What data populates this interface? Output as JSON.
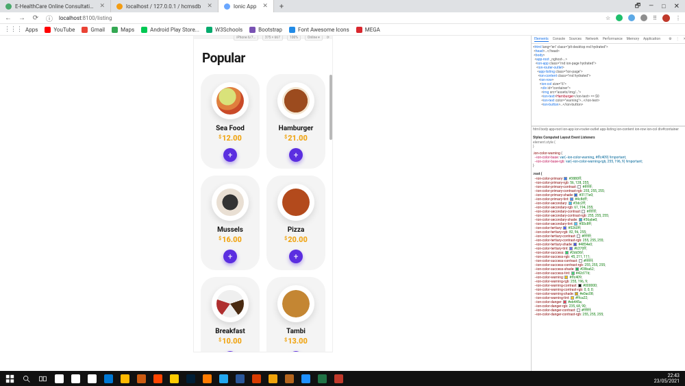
{
  "browser": {
    "tabs": [
      {
        "label": "E-HealthCare Online Consultati…",
        "favicon": "#4aa96c",
        "active": false
      },
      {
        "label": "localhost / 127.0.0.1 / hcmsdb",
        "favicon": "#f39c12",
        "active": false
      },
      {
        "label": "Ionic App",
        "favicon": "#6aa7ff",
        "active": true
      }
    ],
    "addr_host": "localhost",
    "addr_port_path": ":8100/listing",
    "bookmarks": [
      {
        "label": "Apps",
        "color": "#5f6368"
      },
      {
        "label": "YouTube",
        "color": "#ff0000"
      },
      {
        "label": "Gmail",
        "color": "#ea4335"
      },
      {
        "label": "Maps",
        "color": "#34a853"
      },
      {
        "label": "Android Play Store...",
        "color": "#00c853"
      },
      {
        "label": "W3Schools",
        "color": "#04aa6d"
      },
      {
        "label": "Bootstrap",
        "color": "#7952b3"
      },
      {
        "label": "Font Awesome Icons",
        "color": "#228be6"
      },
      {
        "label": "MEGA",
        "color": "#d9272e"
      }
    ]
  },
  "app": {
    "section_title": "Popular",
    "currency": "$",
    "items": [
      {
        "name": "Sea Food",
        "price": "12.00",
        "foodcls": "pf1"
      },
      {
        "name": "Hamburger",
        "price": "21.00",
        "foodcls": "pf2"
      },
      {
        "name": "Mussels",
        "price": "16.00",
        "foodcls": "pf3"
      },
      {
        "name": "Pizza",
        "price": "20.00",
        "foodcls": "pf4"
      },
      {
        "name": "Breakfast",
        "price": "10.00",
        "foodcls": "pf5"
      },
      {
        "name": "Tambi",
        "price": "13.00",
        "foodcls": "pf6"
      }
    ],
    "add_label": "+"
  },
  "devtools": {
    "tabs": [
      "Elements",
      "Console",
      "Sources",
      "Network",
      "Performance",
      "Memory",
      "Application"
    ],
    "active_tab": "Elements",
    "style_rule_selector": ".ion-color-warning",
    "style_rule_props": [
      "--ion-color-base: var(--ion-color-warning, #ffc409) !important;",
      "--ion-color-base-rgb: var(--ion-color-warning-rgb, 255, 196, 9) !important;"
    ],
    "color_vars": [
      {
        "name": "--ion-color-primary",
        "val": "#3880ff",
        "sw": "#3880ff"
      },
      {
        "name": "--ion-color-primary-rgb",
        "val": "56, 128, 255"
      },
      {
        "name": "--ion-color-primary-contrast",
        "val": "#ffffff",
        "sw": "#ffffff"
      },
      {
        "name": "--ion-color-primary-contrast-rgb",
        "val": "255, 255, 255"
      },
      {
        "name": "--ion-color-primary-shade",
        "val": "#3171e0",
        "sw": "#3171e0"
      },
      {
        "name": "--ion-color-primary-tint",
        "val": "#4c8dff",
        "sw": "#4c8dff"
      },
      {
        "name": "--ion-color-secondary",
        "val": "#3dc2ff",
        "sw": "#3dc2ff"
      },
      {
        "name": "--ion-color-secondary-rgb",
        "val": "61, 194, 255"
      },
      {
        "name": "--ion-color-secondary-contrast",
        "val": "#ffffff",
        "sw": "#ffffff"
      },
      {
        "name": "--ion-color-secondary-contrast-rgb",
        "val": "255, 255, 255"
      },
      {
        "name": "--ion-color-secondary-shade",
        "val": "#36abe0",
        "sw": "#36abe0"
      },
      {
        "name": "--ion-color-secondary-tint",
        "val": "#50c8ff",
        "sw": "#50c8ff"
      },
      {
        "name": "--ion-color-tertiary",
        "val": "#5260ff",
        "sw": "#5260ff"
      },
      {
        "name": "--ion-color-tertiary-rgb",
        "val": "82, 96, 255"
      },
      {
        "name": "--ion-color-tertiary-contrast",
        "val": "#ffffff",
        "sw": "#ffffff"
      },
      {
        "name": "--ion-color-tertiary-contrast-rgb",
        "val": "255, 255, 255"
      },
      {
        "name": "--ion-color-tertiary-shade",
        "val": "#4854e0",
        "sw": "#4854e0"
      },
      {
        "name": "--ion-color-tertiary-tint",
        "val": "#6370ff",
        "sw": "#6370ff"
      },
      {
        "name": "--ion-color-success",
        "val": "#2dd36f",
        "sw": "#2dd36f"
      },
      {
        "name": "--ion-color-success-rgb",
        "val": "45, 211, 111"
      },
      {
        "name": "--ion-color-success-contrast",
        "val": "#ffffff",
        "sw": "#ffffff"
      },
      {
        "name": "--ion-color-success-contrast-rgb",
        "val": "255, 255, 255"
      },
      {
        "name": "--ion-color-success-shade",
        "val": "#28ba62",
        "sw": "#28ba62"
      },
      {
        "name": "--ion-color-success-tint",
        "val": "#42d77d",
        "sw": "#42d77d"
      },
      {
        "name": "--ion-color-warning",
        "val": "#ffc409",
        "sw": "#ffc409"
      },
      {
        "name": "--ion-color-warning-rgb",
        "val": "255, 196, 9"
      },
      {
        "name": "--ion-color-warning-contrast",
        "val": "#000000",
        "sw": "#000000"
      },
      {
        "name": "--ion-color-warning-contrast-rgb",
        "val": "0, 0, 0"
      },
      {
        "name": "--ion-color-warning-shade",
        "val": "#e0ac08",
        "sw": "#e0ac08"
      },
      {
        "name": "--ion-color-warning-tint",
        "val": "#ffca22",
        "sw": "#ffca22"
      },
      {
        "name": "--ion-color-danger",
        "val": "#eb445a",
        "sw": "#eb445a"
      },
      {
        "name": "--ion-color-danger-rgb",
        "val": "235, 68, 90"
      },
      {
        "name": "--ion-color-danger-contrast",
        "val": "#ffffff",
        "sw": "#ffffff"
      },
      {
        "name": "--ion-color-danger-contrast-rgb",
        "val": "255, 255, 255"
      }
    ],
    "breadcrumb": "html  body  app-root  ion-app  ion-router-outlet  app-listing  ion-content  ion-row  ion-col  div#container"
  },
  "taskbar": {
    "time": "22:43",
    "date": "23/05/2021",
    "icons": [
      "#ffffff",
      "#ffffff",
      "#ffffff",
      "#0078d4",
      "#ffb900",
      "#cc5b12",
      "#ff4500",
      "#ffcc00",
      "#001e36",
      "#ff7b00",
      "#22a7f0",
      "#2b579a",
      "#d83b01",
      "#f0a30a",
      "#b5651d",
      "#1e90ff",
      "#217346",
      "#c0392b"
    ]
  }
}
